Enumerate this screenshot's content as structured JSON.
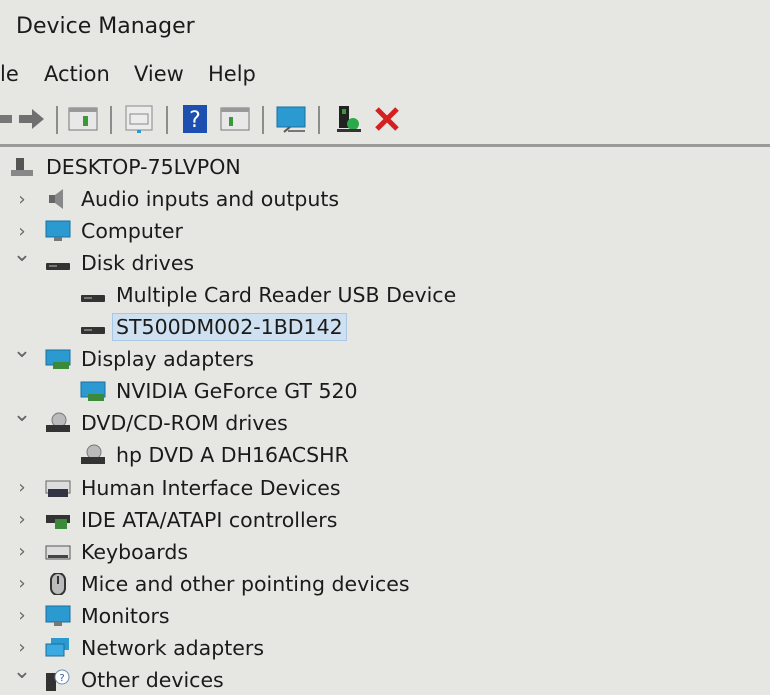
{
  "window": {
    "title": "Device Manager"
  },
  "menu": [
    {
      "label": "le"
    },
    {
      "label": "Action"
    },
    {
      "label": "View"
    },
    {
      "label": "Help"
    }
  ],
  "toolbar": [
    {
      "icon": "back-arrow-icon"
    },
    {
      "icon": "forward-arrow-icon"
    },
    {
      "icon": "properties-icon"
    },
    {
      "icon": "update-driver-icon"
    },
    {
      "icon": "help-icon"
    },
    {
      "icon": "show-hidden-icon"
    },
    {
      "icon": "scan-hardware-icon"
    },
    {
      "icon": "add-driver-icon"
    },
    {
      "icon": "uninstall-icon"
    }
  ],
  "colors": {
    "selection": "#cfe0f0",
    "accent": "#2a7fd0",
    "remove": "#d42020"
  },
  "tree": [
    {
      "label": "DESKTOP-75LVPON",
      "level": 0,
      "expander": "",
      "icon": "computer-root-icon"
    },
    {
      "label": "Audio inputs and outputs",
      "level": 1,
      "expander": "collapsed",
      "icon": "speaker-icon"
    },
    {
      "label": "Computer",
      "level": 1,
      "expander": "collapsed",
      "icon": "monitor-icon"
    },
    {
      "label": "Disk drives",
      "level": 1,
      "expander": "expanded",
      "icon": "disk-icon"
    },
    {
      "label": "Multiple Card  Reader USB Device",
      "level": 2,
      "expander": "",
      "icon": "disk-icon"
    },
    {
      "label": "ST500DM002-1BD142",
      "level": 2,
      "expander": "",
      "icon": "disk-icon",
      "selected": true
    },
    {
      "label": "Display adapters",
      "level": 1,
      "expander": "expanded",
      "icon": "display-adapter-icon"
    },
    {
      "label": "NVIDIA GeForce GT 520",
      "level": 2,
      "expander": "",
      "icon": "display-adapter-icon"
    },
    {
      "label": "DVD/CD-ROM drives",
      "level": 1,
      "expander": "expanded",
      "icon": "dvd-icon"
    },
    {
      "label": "hp DVD A  DH16ACSHR",
      "level": 2,
      "expander": "",
      "icon": "dvd-icon"
    },
    {
      "label": "Human Interface Devices",
      "level": 1,
      "expander": "collapsed",
      "icon": "hid-icon"
    },
    {
      "label": "IDE ATA/ATAPI controllers",
      "level": 1,
      "expander": "collapsed",
      "icon": "ide-controller-icon"
    },
    {
      "label": "Keyboards",
      "level": 1,
      "expander": "collapsed",
      "icon": "keyboard-icon"
    },
    {
      "label": "Mice and other pointing devices",
      "level": 1,
      "expander": "collapsed",
      "icon": "mouse-icon"
    },
    {
      "label": "Monitors",
      "level": 1,
      "expander": "collapsed",
      "icon": "monitor-icon"
    },
    {
      "label": "Network adapters",
      "level": 1,
      "expander": "collapsed",
      "icon": "network-icon"
    },
    {
      "label": "Other devices",
      "level": 1,
      "expander": "expanded",
      "icon": "unknown-device-icon"
    }
  ]
}
